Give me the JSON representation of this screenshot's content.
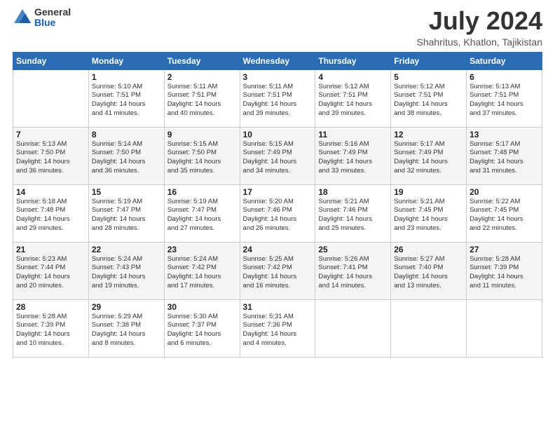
{
  "header": {
    "logo_general": "General",
    "logo_blue": "Blue",
    "month_title": "July 2024",
    "location": "Shahritus, Khatlon, Tajikistan"
  },
  "days_of_week": [
    "Sunday",
    "Monday",
    "Tuesday",
    "Wednesday",
    "Thursday",
    "Friday",
    "Saturday"
  ],
  "weeks": [
    [
      {
        "day": "",
        "info": ""
      },
      {
        "day": "1",
        "info": "Sunrise: 5:10 AM\nSunset: 7:51 PM\nDaylight: 14 hours\nand 41 minutes."
      },
      {
        "day": "2",
        "info": "Sunrise: 5:11 AM\nSunset: 7:51 PM\nDaylight: 14 hours\nand 40 minutes."
      },
      {
        "day": "3",
        "info": "Sunrise: 5:11 AM\nSunset: 7:51 PM\nDaylight: 14 hours\nand 39 minutes."
      },
      {
        "day": "4",
        "info": "Sunrise: 5:12 AM\nSunset: 7:51 PM\nDaylight: 14 hours\nand 39 minutes."
      },
      {
        "day": "5",
        "info": "Sunrise: 5:12 AM\nSunset: 7:51 PM\nDaylight: 14 hours\nand 38 minutes."
      },
      {
        "day": "6",
        "info": "Sunrise: 5:13 AM\nSunset: 7:51 PM\nDaylight: 14 hours\nand 37 minutes."
      }
    ],
    [
      {
        "day": "7",
        "info": "Sunrise: 5:13 AM\nSunset: 7:50 PM\nDaylight: 14 hours\nand 36 minutes."
      },
      {
        "day": "8",
        "info": "Sunrise: 5:14 AM\nSunset: 7:50 PM\nDaylight: 14 hours\nand 36 minutes."
      },
      {
        "day": "9",
        "info": "Sunrise: 5:15 AM\nSunset: 7:50 PM\nDaylight: 14 hours\nand 35 minutes."
      },
      {
        "day": "10",
        "info": "Sunrise: 5:15 AM\nSunset: 7:49 PM\nDaylight: 14 hours\nand 34 minutes."
      },
      {
        "day": "11",
        "info": "Sunrise: 5:16 AM\nSunset: 7:49 PM\nDaylight: 14 hours\nand 33 minutes."
      },
      {
        "day": "12",
        "info": "Sunrise: 5:17 AM\nSunset: 7:49 PM\nDaylight: 14 hours\nand 32 minutes."
      },
      {
        "day": "13",
        "info": "Sunrise: 5:17 AM\nSunset: 7:48 PM\nDaylight: 14 hours\nand 31 minutes."
      }
    ],
    [
      {
        "day": "14",
        "info": "Sunrise: 5:18 AM\nSunset: 7:48 PM\nDaylight: 14 hours\nand 29 minutes."
      },
      {
        "day": "15",
        "info": "Sunrise: 5:19 AM\nSunset: 7:47 PM\nDaylight: 14 hours\nand 28 minutes."
      },
      {
        "day": "16",
        "info": "Sunrise: 5:19 AM\nSunset: 7:47 PM\nDaylight: 14 hours\nand 27 minutes."
      },
      {
        "day": "17",
        "info": "Sunrise: 5:20 AM\nSunset: 7:46 PM\nDaylight: 14 hours\nand 26 minutes."
      },
      {
        "day": "18",
        "info": "Sunrise: 5:21 AM\nSunset: 7:46 PM\nDaylight: 14 hours\nand 25 minutes."
      },
      {
        "day": "19",
        "info": "Sunrise: 5:21 AM\nSunset: 7:45 PM\nDaylight: 14 hours\nand 23 minutes."
      },
      {
        "day": "20",
        "info": "Sunrise: 5:22 AM\nSunset: 7:45 PM\nDaylight: 14 hours\nand 22 minutes."
      }
    ],
    [
      {
        "day": "21",
        "info": "Sunrise: 5:23 AM\nSunset: 7:44 PM\nDaylight: 14 hours\nand 20 minutes."
      },
      {
        "day": "22",
        "info": "Sunrise: 5:24 AM\nSunset: 7:43 PM\nDaylight: 14 hours\nand 19 minutes."
      },
      {
        "day": "23",
        "info": "Sunrise: 5:24 AM\nSunset: 7:42 PM\nDaylight: 14 hours\nand 17 minutes."
      },
      {
        "day": "24",
        "info": "Sunrise: 5:25 AM\nSunset: 7:42 PM\nDaylight: 14 hours\nand 16 minutes."
      },
      {
        "day": "25",
        "info": "Sunrise: 5:26 AM\nSunset: 7:41 PM\nDaylight: 14 hours\nand 14 minutes."
      },
      {
        "day": "26",
        "info": "Sunrise: 5:27 AM\nSunset: 7:40 PM\nDaylight: 14 hours\nand 13 minutes."
      },
      {
        "day": "27",
        "info": "Sunrise: 5:28 AM\nSunset: 7:39 PM\nDaylight: 14 hours\nand 11 minutes."
      }
    ],
    [
      {
        "day": "28",
        "info": "Sunrise: 5:28 AM\nSunset: 7:39 PM\nDaylight: 14 hours\nand 10 minutes."
      },
      {
        "day": "29",
        "info": "Sunrise: 5:29 AM\nSunset: 7:38 PM\nDaylight: 14 hours\nand 8 minutes."
      },
      {
        "day": "30",
        "info": "Sunrise: 5:30 AM\nSunset: 7:37 PM\nDaylight: 14 hours\nand 6 minutes."
      },
      {
        "day": "31",
        "info": "Sunrise: 5:31 AM\nSunset: 7:36 PM\nDaylight: 14 hours\nand 4 minutes."
      },
      {
        "day": "",
        "info": ""
      },
      {
        "day": "",
        "info": ""
      },
      {
        "day": "",
        "info": ""
      }
    ]
  ]
}
